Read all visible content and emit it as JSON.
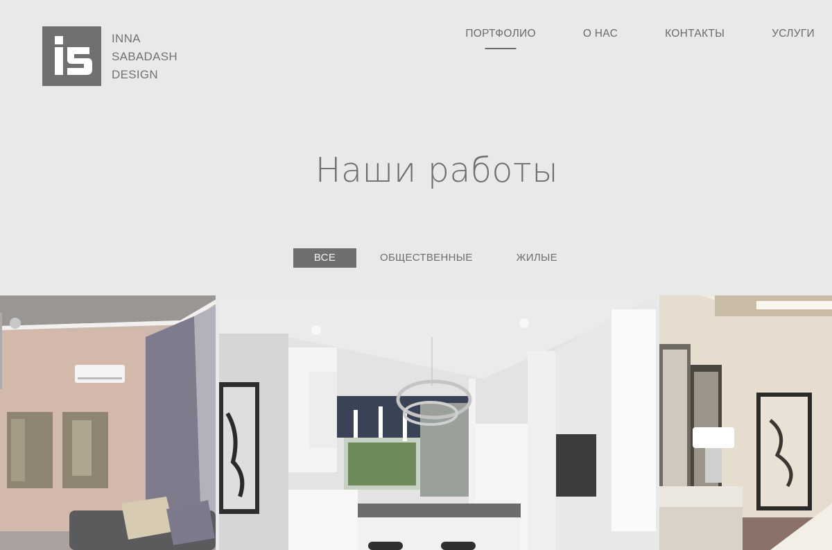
{
  "brand": {
    "line1": "INNA",
    "line2": "SABADASH",
    "line3": "DESIGN",
    "mark_color": "#707070"
  },
  "nav": {
    "items": [
      {
        "label": "ПОРТФОЛИО",
        "active": true
      },
      {
        "label": "О НАС",
        "active": false
      },
      {
        "label": "КОНТАКТЫ",
        "active": false
      },
      {
        "label": "УСЛУГИ",
        "active": false
      }
    ]
  },
  "main": {
    "title": "Наши работы"
  },
  "filters": {
    "items": [
      {
        "label": "ВСЕ",
        "active": true
      },
      {
        "label": "ОБЩЕСТВЕННЫЕ",
        "active": false
      },
      {
        "label": "ЖИЛЫЕ",
        "active": false
      }
    ]
  },
  "colors": {
    "background": "#e9e9e9",
    "text": "#6e6e6e",
    "active_filter_bg": "#6f6f6f"
  }
}
